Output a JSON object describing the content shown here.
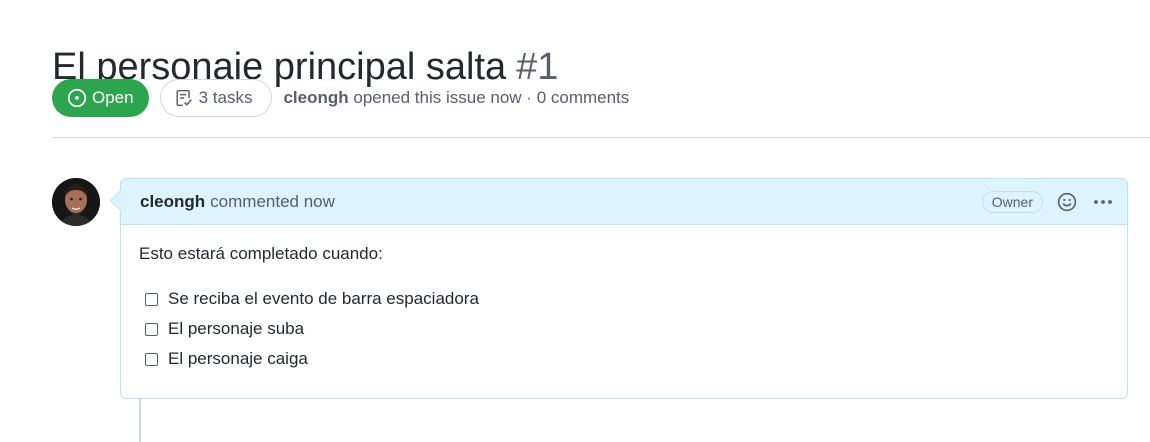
{
  "issue": {
    "title": "El personaje principal salta",
    "number": "#1",
    "state": "Open",
    "tasks_label": "3 tasks",
    "author": "cleongh",
    "meta_suffix": "opened this issue now · 0 comments"
  },
  "comment": {
    "author": "cleongh",
    "time": "commented now",
    "role_badge": "Owner",
    "intro": "Esto estará completado cuando:",
    "tasks": [
      {
        "label": "Se reciba el evento de barra espaciadora",
        "checked": false
      },
      {
        "label": "El personaje suba",
        "checked": false
      },
      {
        "label": "El personaje caiga",
        "checked": false
      }
    ]
  },
  "icons": {
    "state": "issue-opened-icon",
    "tasks": "checklist-icon",
    "reaction": "smiley-icon",
    "more": "kebab-horizontal-icon"
  },
  "colors": {
    "open_green": "#2da44e",
    "header_blue": "#ddf4ff",
    "border_blue": "#b6e3ff",
    "muted_text": "#57606a"
  }
}
